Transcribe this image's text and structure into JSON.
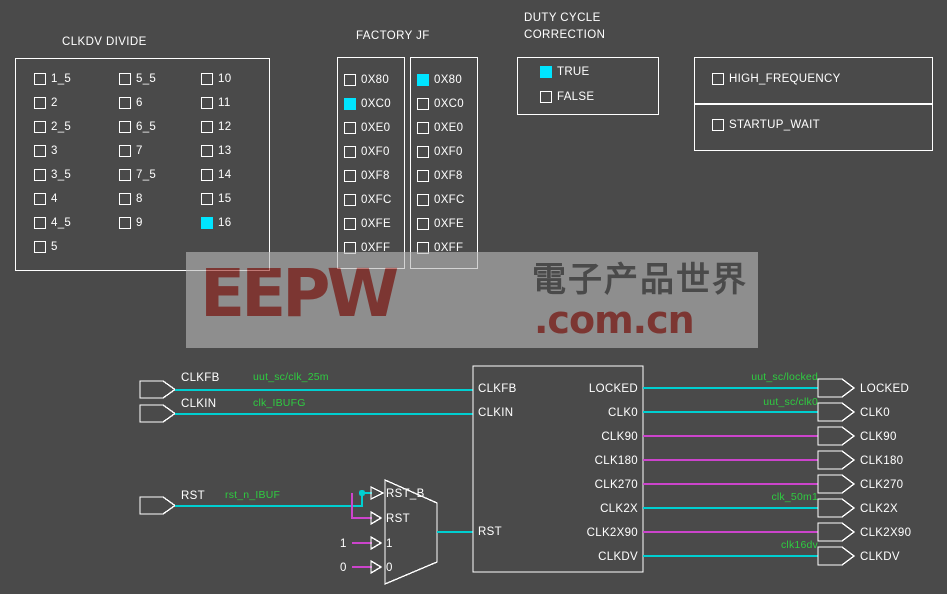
{
  "canvas": {
    "background": "#4a4a4a",
    "accent_checked": "#00e5ff",
    "wire_clock": "#00cfd1",
    "wire_bus": "#cc44cc",
    "net_label_color": "#2ecc40",
    "outline": "#ffffff"
  },
  "groups": {
    "clkdv_divide": {
      "title": "CLKDV DIVIDE",
      "columns": [
        [
          {
            "label": "1_5",
            "checked": false
          },
          {
            "label": "2",
            "checked": false
          },
          {
            "label": "2_5",
            "checked": false
          },
          {
            "label": "3",
            "checked": false
          },
          {
            "label": "3_5",
            "checked": false
          },
          {
            "label": "4",
            "checked": false
          },
          {
            "label": "4_5",
            "checked": false
          },
          {
            "label": "5",
            "checked": false
          }
        ],
        [
          {
            "label": "5_5",
            "checked": false
          },
          {
            "label": "6",
            "checked": false
          },
          {
            "label": "6_5",
            "checked": false
          },
          {
            "label": "7",
            "checked": false
          },
          {
            "label": "7_5",
            "checked": false
          },
          {
            "label": "8",
            "checked": false
          },
          {
            "label": "9",
            "checked": false
          }
        ],
        [
          {
            "label": "10",
            "checked": false
          },
          {
            "label": "11",
            "checked": false
          },
          {
            "label": "12",
            "checked": false
          },
          {
            "label": "13",
            "checked": false
          },
          {
            "label": "14",
            "checked": false
          },
          {
            "label": "15",
            "checked": false
          },
          {
            "label": "16",
            "checked": true
          }
        ]
      ]
    },
    "factory_jf": {
      "title": "FACTORY JF",
      "columns": [
        [
          {
            "label": "0X80",
            "checked": false
          },
          {
            "label": "0XC0",
            "checked": true
          },
          {
            "label": "0XE0",
            "checked": false
          },
          {
            "label": "0XF0",
            "checked": false
          },
          {
            "label": "0XF8",
            "checked": false
          },
          {
            "label": "0XFC",
            "checked": false
          },
          {
            "label": "0XFE",
            "checked": false
          },
          {
            "label": "0XFF",
            "checked": false
          }
        ],
        [
          {
            "label": "0X80",
            "checked": true
          },
          {
            "label": "0XC0",
            "checked": false
          },
          {
            "label": "0XE0",
            "checked": false
          },
          {
            "label": "0XF0",
            "checked": false
          },
          {
            "label": "0XF8",
            "checked": false
          },
          {
            "label": "0XFC",
            "checked": false
          },
          {
            "label": "0XFE",
            "checked": false
          },
          {
            "label": "0XFF",
            "checked": false
          }
        ]
      ]
    },
    "duty_cycle_correction": {
      "title_line1": "DUTY CYCLE",
      "title_line2": "CORRECTION",
      "options": [
        {
          "label": "TRUE",
          "checked": true
        },
        {
          "label": "FALSE",
          "checked": false
        }
      ]
    },
    "flags": {
      "high_frequency": {
        "label": "HIGH_FREQUENCY",
        "checked": false
      },
      "startup_wait": {
        "label": "STARTUP_WAIT",
        "checked": false
      }
    }
  },
  "schematic": {
    "inputs": [
      {
        "name": "CLKFB",
        "net": "uut_sc/clk_25m"
      },
      {
        "name": "CLKIN",
        "net": "clk_IBUFG"
      },
      {
        "name": "RST",
        "net": "rst_n_IBUF"
      }
    ],
    "mux": {
      "pins": [
        {
          "label": "RST_B",
          "driver": ""
        },
        {
          "label": "RST",
          "driver": ""
        },
        {
          "label": "1",
          "driver": "1"
        },
        {
          "label": "0",
          "driver": "0"
        }
      ]
    },
    "dcm": {
      "inputs": [
        "CLKFB",
        "CLKIN",
        "RST"
      ],
      "outputs": [
        "LOCKED",
        "CLK0",
        "CLK90",
        "CLK180",
        "CLK270",
        "CLK2X",
        "CLK2X90",
        "CLKDV"
      ]
    },
    "outputs": [
      {
        "name": "LOCKED",
        "net": "uut_sc/locked"
      },
      {
        "name": "CLK0",
        "net": "uut_sc/clk0"
      },
      {
        "name": "CLK90",
        "net": ""
      },
      {
        "name": "CLK180",
        "net": ""
      },
      {
        "name": "CLK270",
        "net": ""
      },
      {
        "name": "CLK2X",
        "net": "clk_50m1"
      },
      {
        "name": "CLK2X90",
        "net": ""
      },
      {
        "name": "CLKDV",
        "net": "clk16dv"
      }
    ]
  },
  "watermark": {
    "brand": "EEPW",
    "chinese": "電子产品世界",
    "domain": ".com.cn"
  }
}
